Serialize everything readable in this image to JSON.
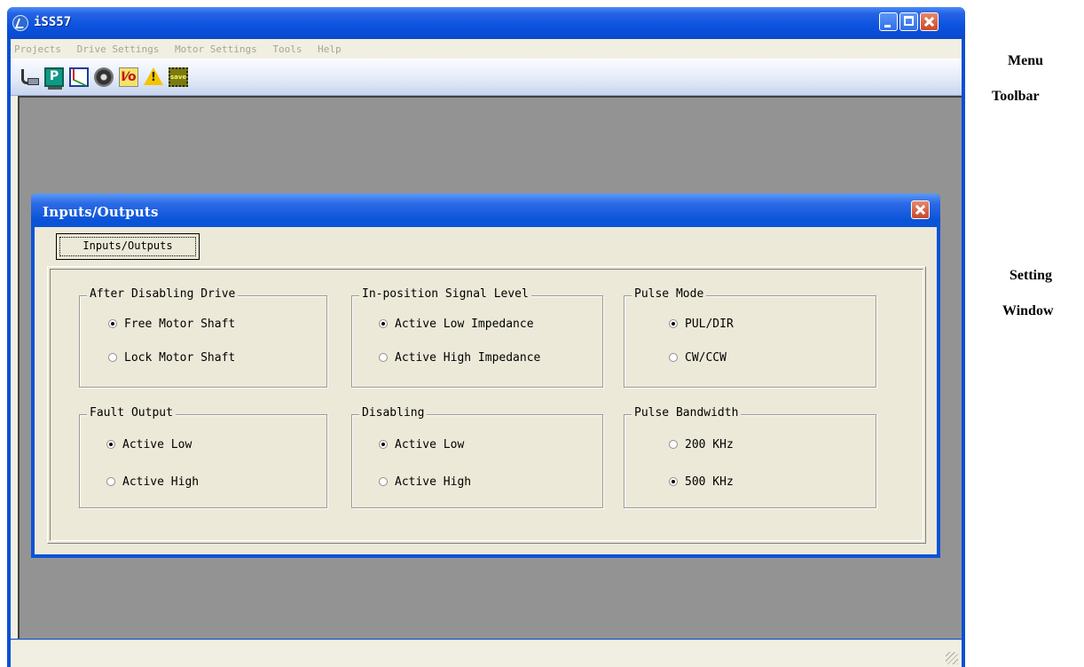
{
  "app": {
    "title": "iSS57"
  },
  "menu": [
    "Projects",
    "Drive Settings",
    "Motor Settings",
    "Tools",
    "Help"
  ],
  "toolbar": {
    "icons": [
      "connect-icon",
      "parameters-icon",
      "scope-icon",
      "motor-icon",
      "io-icon",
      "alarm-icon",
      "save-icon"
    ],
    "io_label": "I/O",
    "save_label": "save"
  },
  "dialog": {
    "title": "Inputs/Outputs",
    "tab": "Inputs/Outputs",
    "groups": [
      {
        "title": "After Disabling Drive",
        "options": [
          "Free Motor Shaft",
          "Lock Motor Shaft"
        ],
        "selected": 0
      },
      {
        "title": "In-position Signal Level",
        "options": [
          "Active Low Impedance",
          "Active High Impedance"
        ],
        "selected": 0
      },
      {
        "title": "Pulse Mode",
        "options": [
          "PUL/DIR",
          "CW/CCW"
        ],
        "selected": 0
      },
      {
        "title": "Fault Output",
        "options": [
          "Active Low",
          "Active High"
        ],
        "selected": 0
      },
      {
        "title": "Disabling",
        "options": [
          "Active Low",
          "Active High"
        ],
        "selected": 0
      },
      {
        "title": "Pulse Bandwidth",
        "options": [
          "200 KHz",
          "500 KHz"
        ],
        "selected": 1
      }
    ]
  },
  "annotations": {
    "menu": "Menu",
    "toolbar": "Toolbar",
    "setting": "Setting",
    "window": "Window"
  },
  "colors": {
    "titlebar": "#0a52dd",
    "workspace": "#939393",
    "dialog_face": "#ece9d8"
  }
}
